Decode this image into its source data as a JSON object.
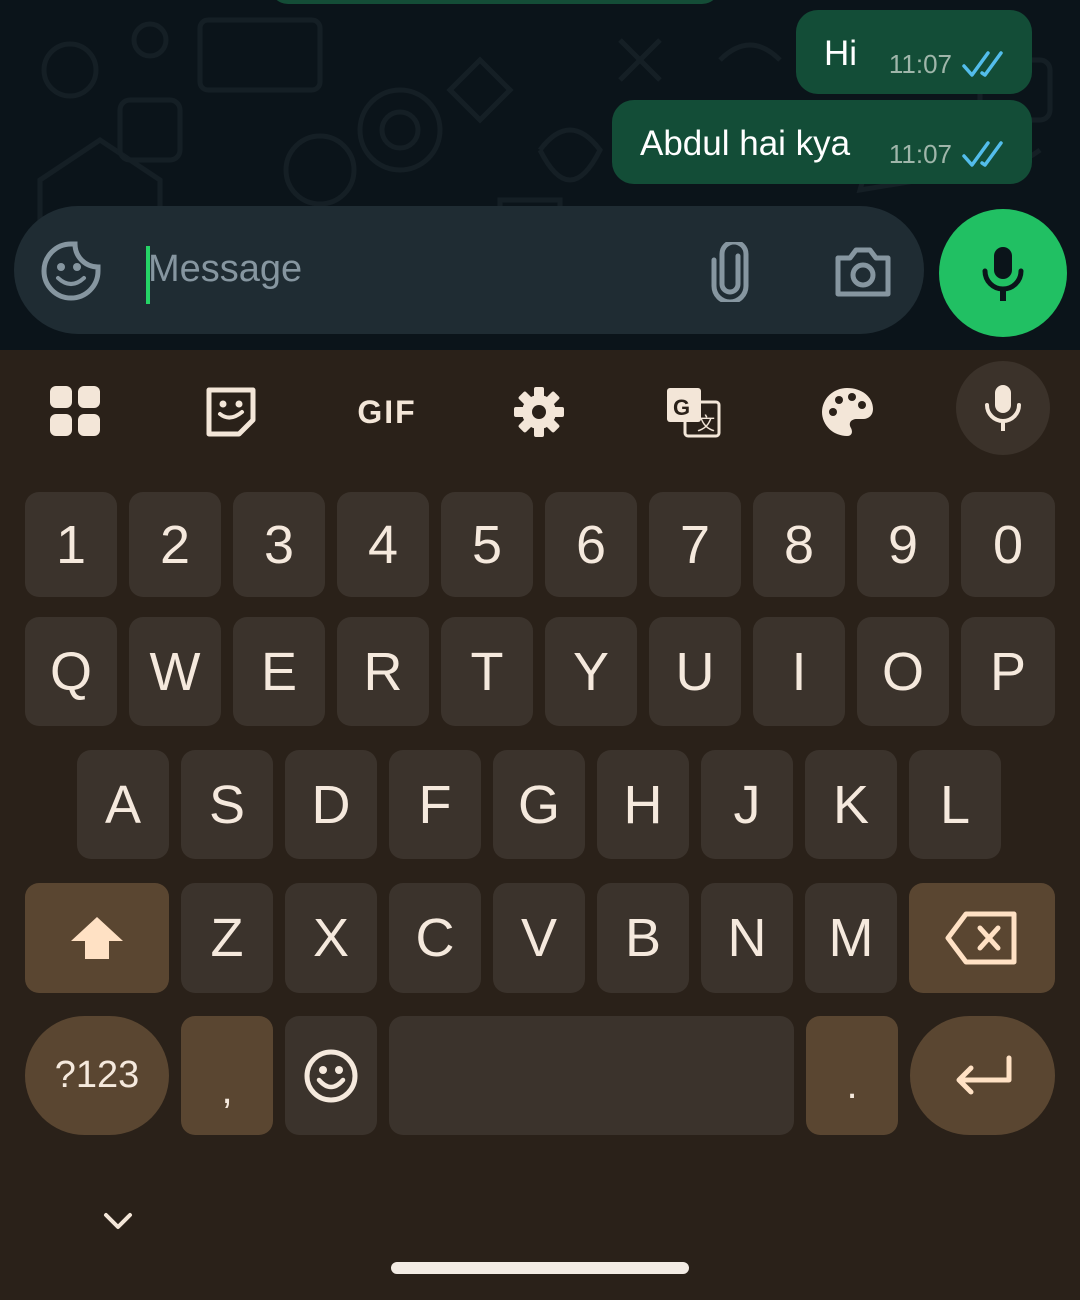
{
  "chat": {
    "messages": [
      {
        "text": "Hi",
        "time": "11:07",
        "status": "read-double-check-icon"
      },
      {
        "text": "Abdul hai kya",
        "time": "11:07",
        "status": "read-double-check-icon"
      }
    ],
    "composer": {
      "placeholder": "Message"
    }
  },
  "keyboard": {
    "toolbar": {
      "items": [
        "apps-grid-icon",
        "sticker-icon",
        "GIF",
        "settings-gear-icon",
        "translate-icon",
        "theme-palette-icon",
        "voice-input-icon"
      ]
    },
    "rows": {
      "numbers": [
        "1",
        "2",
        "3",
        "4",
        "5",
        "6",
        "7",
        "8",
        "9",
        "0"
      ],
      "row1": [
        "Q",
        "W",
        "E",
        "R",
        "T",
        "Y",
        "U",
        "I",
        "O",
        "P"
      ],
      "row2": [
        "A",
        "S",
        "D",
        "F",
        "G",
        "H",
        "J",
        "K",
        "L"
      ],
      "row3": [
        "Z",
        "X",
        "C",
        "V",
        "B",
        "N",
        "M"
      ]
    },
    "bottom": {
      "symbols_label": "?123",
      "comma": ",",
      "period": "."
    }
  },
  "colors": {
    "chat_bg": "#0b141a",
    "bubble_out": "#134d37",
    "accent_green": "#21c063",
    "tick_blue": "#53bdeb",
    "keyboard_bg": "#2a2119",
    "key_bg": "#3b332c",
    "key_special": "#5a4631"
  }
}
